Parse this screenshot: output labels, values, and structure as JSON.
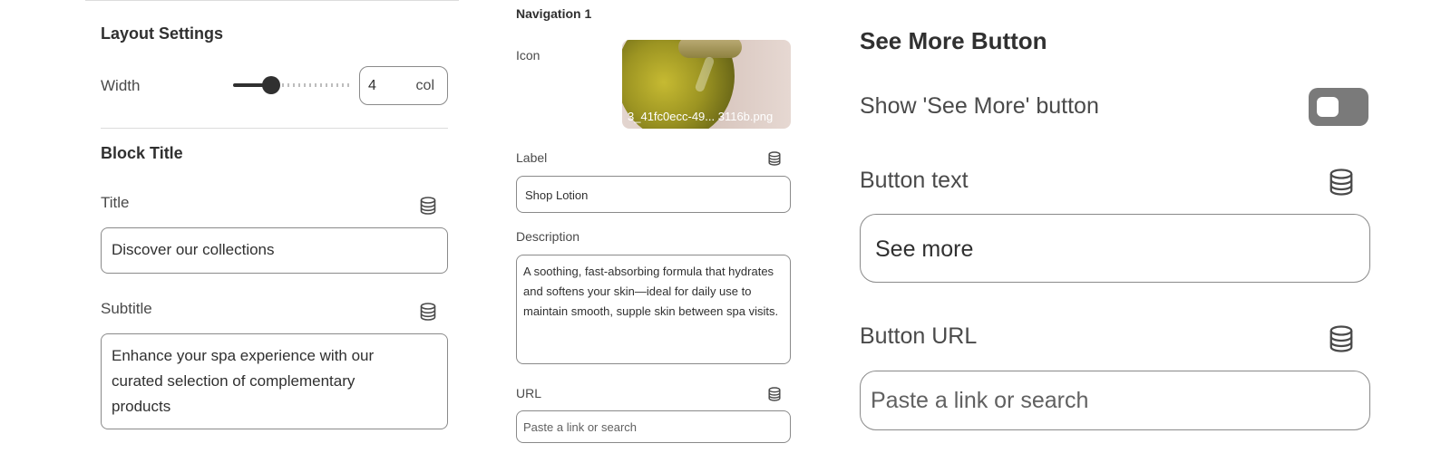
{
  "layout_settings": {
    "heading": "Layout Settings",
    "width_label": "Width",
    "width_value": "4",
    "width_unit": "col",
    "width_slider_fraction": 0.3
  },
  "block_title": {
    "heading": "Block Title",
    "title_label": "Title",
    "title_value": "Discover our collections",
    "subtitle_label": "Subtitle",
    "subtitle_value": "Enhance your spa experience with our curated selection of complementary products"
  },
  "navigation": {
    "heading": "Navigation 1",
    "icon_label": "Icon",
    "icon_filename": "3_41fc0ecc-49... 3116b.png",
    "label_label": "Label",
    "label_value": "Shop Lotion",
    "description_label": "Description",
    "description_value": "A soothing, fast-absorbing formula that hydrates and softens your skin—ideal for daily use to maintain smooth, supple skin between spa visits.",
    "url_label": "URL",
    "url_placeholder": "Paste a link or search"
  },
  "see_more": {
    "heading": "See More Button",
    "show_label": "Show 'See More' button",
    "show_enabled": false,
    "button_text_label": "Button text",
    "button_text_value": "See more",
    "button_url_label": "Button URL",
    "button_url_placeholder": "Paste a link or search"
  },
  "icons": {
    "dynamic_source": "database-icon"
  }
}
